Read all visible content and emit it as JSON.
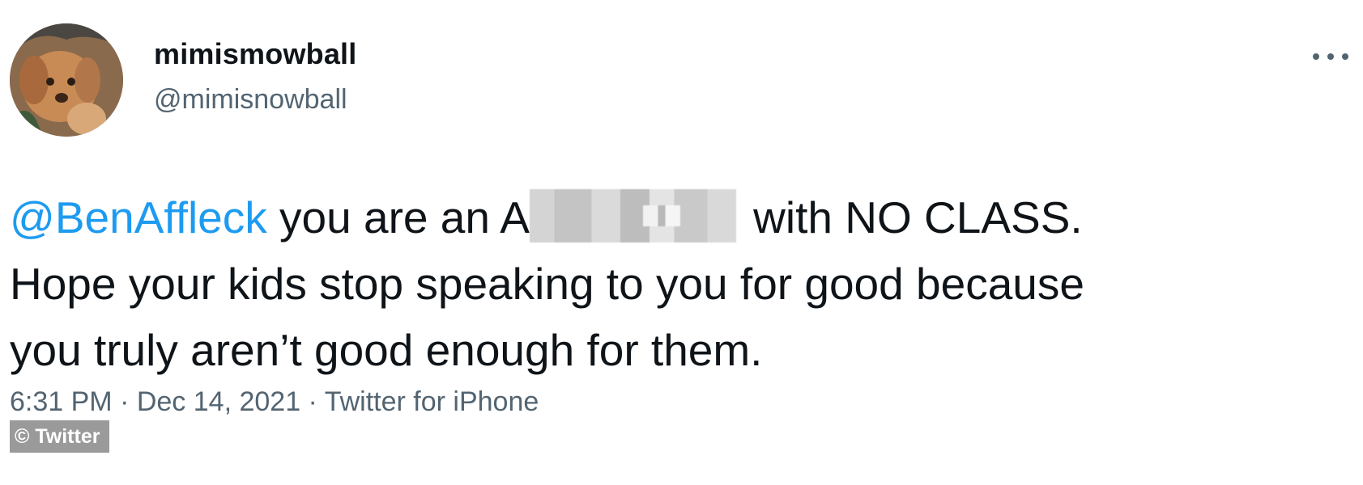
{
  "author": {
    "display_name": "mimismowball",
    "handle": "@mimisnowball"
  },
  "tweet": {
    "mention": "@BenAffleck",
    "text_part1": " you are an A",
    "text_part2": "with NO CLASS.",
    "text_line2": "Hope your kids stop speaking to you for good because",
    "text_line3": "you truly aren’t good enough for them."
  },
  "meta": {
    "time": "6:31 PM",
    "date": "Dec 14, 2021",
    "source": "Twitter for iPhone",
    "separator": " · "
  },
  "credit": "© Twitter",
  "icons": {
    "more": "more-icon",
    "avatar": "avatar"
  },
  "colors": {
    "mention": "#1d9bf0",
    "secondary_text": "#536471",
    "primary_text": "#0f1419"
  }
}
